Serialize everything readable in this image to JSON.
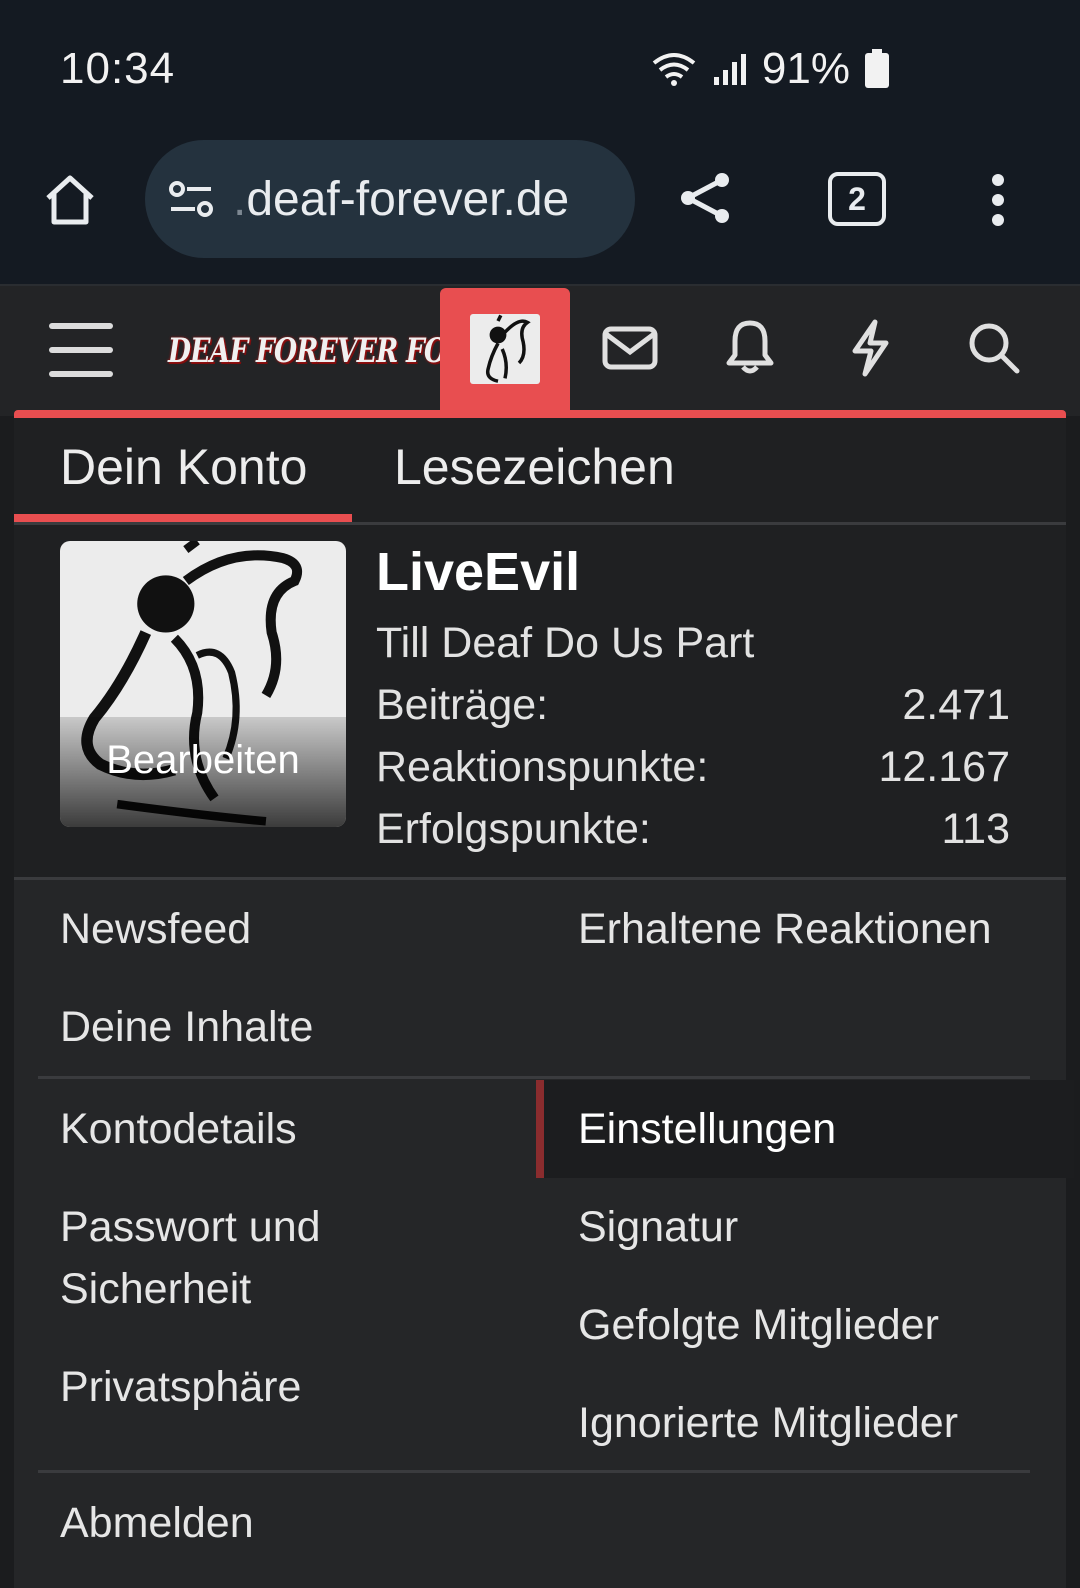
{
  "statusbar": {
    "time": "10:34",
    "battery": "91%"
  },
  "browser": {
    "url_prefix": ".",
    "url_domain": "deaf-forever.de",
    "tab_count": "2"
  },
  "forum": {
    "logo_text": "DEAF FOREVER FORUM"
  },
  "tabs": {
    "account": "Dein Konto",
    "bookmarks": "Lesezeichen"
  },
  "profile": {
    "username": "LiveEvil",
    "title": "Till Deaf Do Us Part",
    "edit_label": "Bearbeiten",
    "stats": [
      {
        "label": "Beiträge:",
        "value": "2.471"
      },
      {
        "label": "Reaktionspunkte:",
        "value": "12.167"
      },
      {
        "label": "Erfolgspunkte:",
        "value": "113"
      }
    ]
  },
  "menu": {
    "newsfeed": "Newsfeed",
    "reactions": "Erhaltene Reaktionen",
    "content": "Deine Inhalte",
    "account_details": "Kontodetails",
    "settings": "Einstellungen",
    "password_line1": "Passwort und",
    "password_line2": "Sicherheit",
    "signature": "Signatur",
    "followed": "Gefolgte Mitglieder",
    "privacy": "Privatsphäre",
    "ignored": "Ignorierte Mitglieder",
    "logout": "Abmelden"
  }
}
